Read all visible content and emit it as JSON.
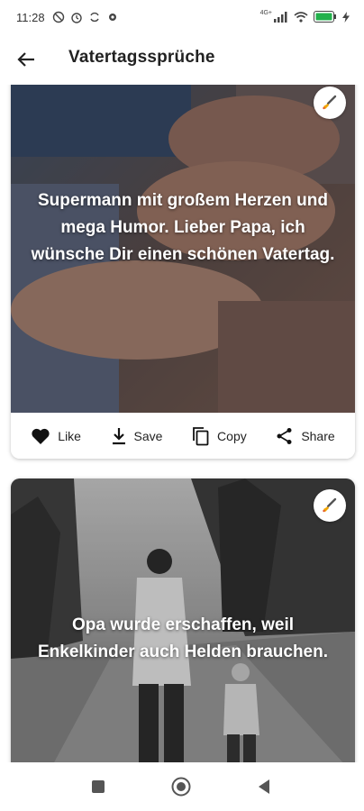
{
  "status_bar": {
    "time": "11:28",
    "icons_left": [
      "do-not-disturb-icon",
      "alarm-icon",
      "sync-icon",
      "settings-icon"
    ],
    "icons_right": [
      "cellular-signal-icon",
      "wifi-icon",
      "battery-icon",
      "charging-icon"
    ],
    "network_label": "4G+"
  },
  "app_bar": {
    "title": "Vatertagssprüche",
    "back_icon": "arrow-left-icon"
  },
  "cards": [
    {
      "quote": "Supermann mit großem Herzen und mega Humor. Lieber Papa, ich wünsche Dir einen schönen Vatertag.",
      "actions": {
        "like": "Like",
        "save": "Save",
        "copy": "Copy",
        "share": "Share"
      }
    },
    {
      "quote": "Opa wurde erschaffen, weil Enkelkinder auch Helden brauchen."
    }
  ],
  "nav_bar": {
    "icons": [
      "recents-square-icon",
      "home-circle-icon",
      "back-triangle-icon"
    ]
  },
  "colors": {
    "battery": "#22b14c",
    "text": "#222222",
    "background": "#ffffff"
  }
}
